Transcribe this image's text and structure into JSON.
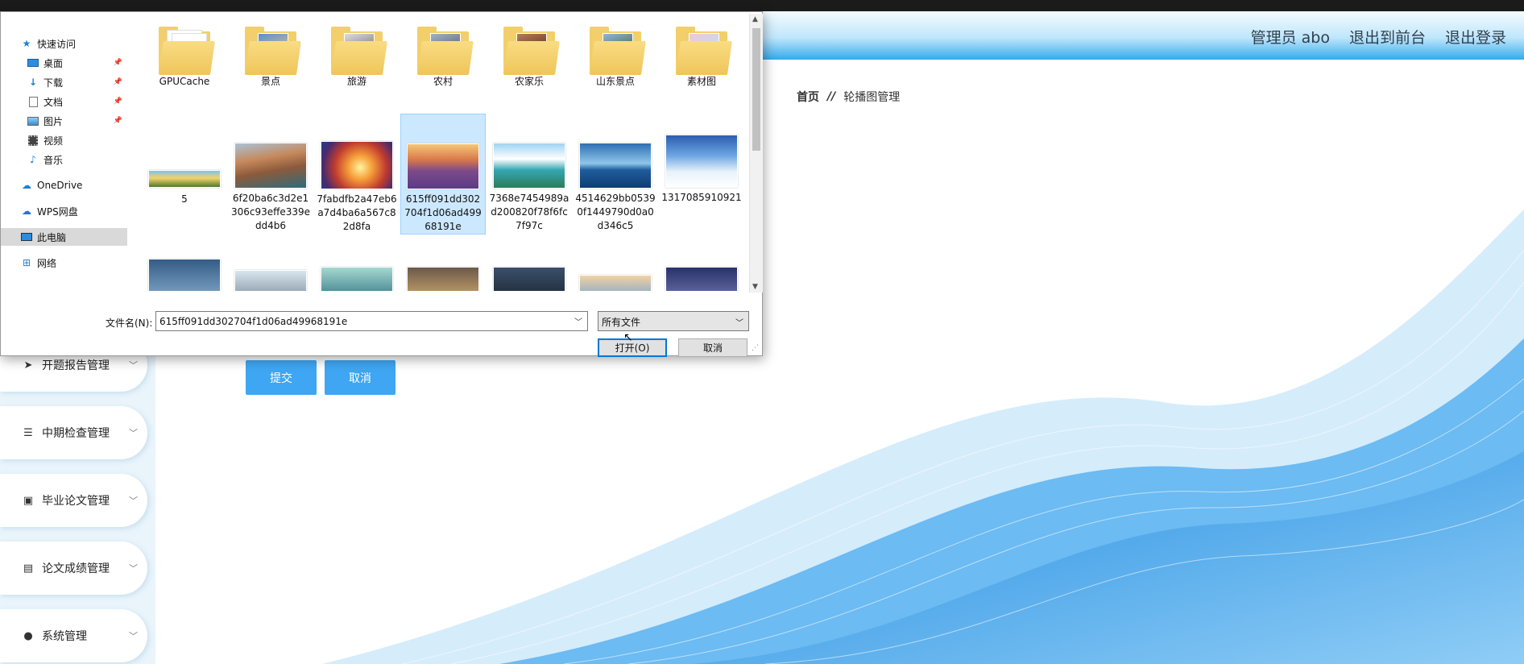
{
  "header": {
    "admin": "管理员 abo",
    "to_front": "退出到前台",
    "logout": "退出登录"
  },
  "breadcrumb": {
    "home": "首页",
    "separator": "//",
    "current": "轮播图管理"
  },
  "sidebar": {
    "items": [
      {
        "label": "开题报告管理",
        "icon": "paper-plane-icon"
      },
      {
        "label": "中期检查管理",
        "icon": "sliders-icon"
      },
      {
        "label": "毕业论文管理",
        "icon": "document-x-icon"
      },
      {
        "label": "论文成绩管理",
        "icon": "clipboard-icon"
      },
      {
        "label": "系统管理",
        "icon": "user-icon"
      }
    ]
  },
  "form": {
    "submit": "提交",
    "cancel": "取消"
  },
  "dialog": {
    "nav": [
      {
        "label": "快速访问",
        "icon": "star-icon"
      },
      {
        "label": "桌面",
        "icon": "desktop-icon",
        "pinned": true
      },
      {
        "label": "下载",
        "icon": "download-icon",
        "pinned": true
      },
      {
        "label": "文档",
        "icon": "document-icon",
        "pinned": true
      },
      {
        "label": "图片",
        "icon": "pictures-icon",
        "pinned": true
      },
      {
        "label": "视频",
        "icon": "video-icon"
      },
      {
        "label": "音乐",
        "icon": "music-icon"
      },
      {
        "label": "OneDrive",
        "icon": "cloud-icon"
      },
      {
        "label": "WPS网盘",
        "icon": "cloud-icon"
      },
      {
        "label": "此电脑",
        "icon": "computer-icon",
        "selected": true
      },
      {
        "label": "网络",
        "icon": "network-icon"
      }
    ],
    "folders": [
      {
        "label": "GPUCache"
      },
      {
        "label": "景点"
      },
      {
        "label": "旅游"
      },
      {
        "label": "农村"
      },
      {
        "label": "农家乐"
      },
      {
        "label": "山东景点"
      },
      {
        "label": "素材图"
      }
    ],
    "images": [
      {
        "label": "5"
      },
      {
        "label": "6f20ba6c3d2e1306c93effe339edd4b6"
      },
      {
        "label": "7fabdfb2a47eb6a7d4ba6a567c82d8fa"
      },
      {
        "label": "615ff091dd302704f1d06ad49968191e",
        "selected": true
      },
      {
        "label": "7368e7454989ad200820f78f6fc7f97c"
      },
      {
        "label": "4514629bb05390f1449790d0a0d346c5"
      },
      {
        "label": "1317085910921"
      }
    ],
    "filename_label": "文件名(N):",
    "filename_value": "615ff091dd302704f1d06ad49968191e",
    "filetype": "所有文件",
    "open_button": "打开(O)",
    "cancel_button": "取消"
  },
  "colors": {
    "accent": "#3ea6f2",
    "selection": "#cce8ff",
    "dialog_primary_border": "#0078d7"
  }
}
